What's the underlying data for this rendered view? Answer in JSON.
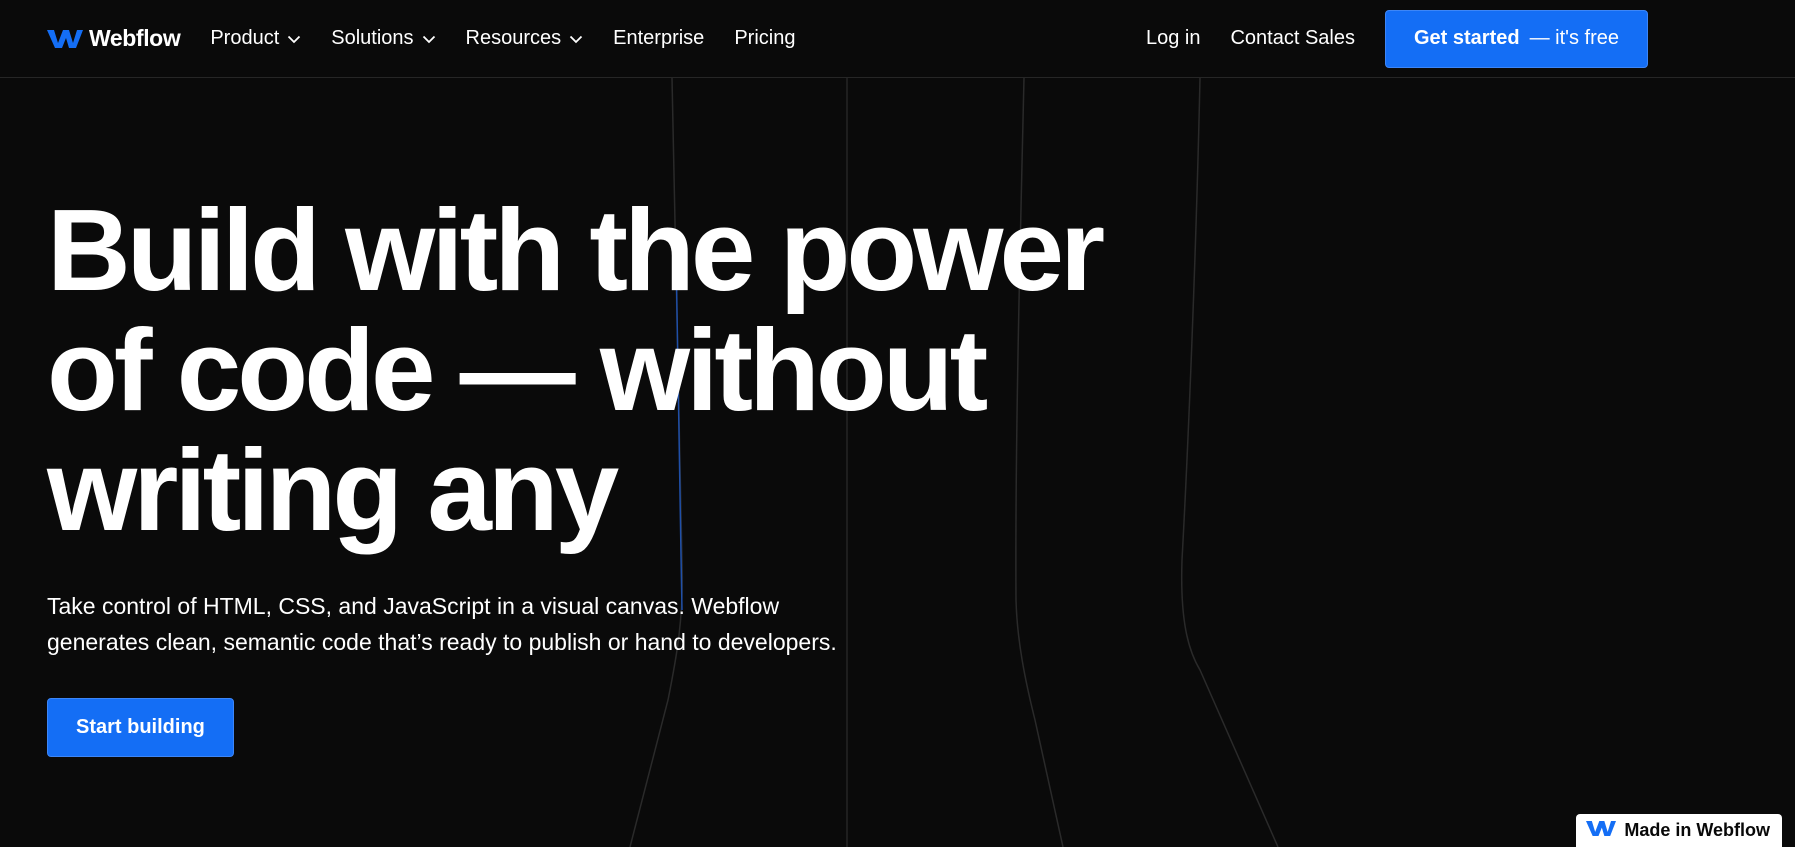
{
  "brand": {
    "name": "Webflow",
    "accent": "#146ef5",
    "background": "#0a0a0a",
    "text": "#ffffff",
    "logo_icon": "webflow-logo-icon"
  },
  "nav": {
    "left_items": [
      {
        "label": "Product",
        "has_dropdown": true
      },
      {
        "label": "Solutions",
        "has_dropdown": true
      },
      {
        "label": "Resources",
        "has_dropdown": true
      },
      {
        "label": "Enterprise",
        "has_dropdown": false
      },
      {
        "label": "Pricing",
        "has_dropdown": false
      }
    ],
    "login_label": "Log in",
    "contact_label": "Contact Sales",
    "cta_strong": "Get started",
    "cta_rest": "— it's free"
  },
  "hero": {
    "title_lines": [
      "Build with the power",
      "of code — without",
      "writing any"
    ],
    "subtitle_lines": [
      "Take control of HTML, CSS, and JavaScript in a visual canvas. Webflow",
      "generates clean, semantic code that’s ready to publish or hand to developers."
    ],
    "cta_label": "Start building"
  },
  "badge": {
    "label": "Made in Webflow"
  }
}
